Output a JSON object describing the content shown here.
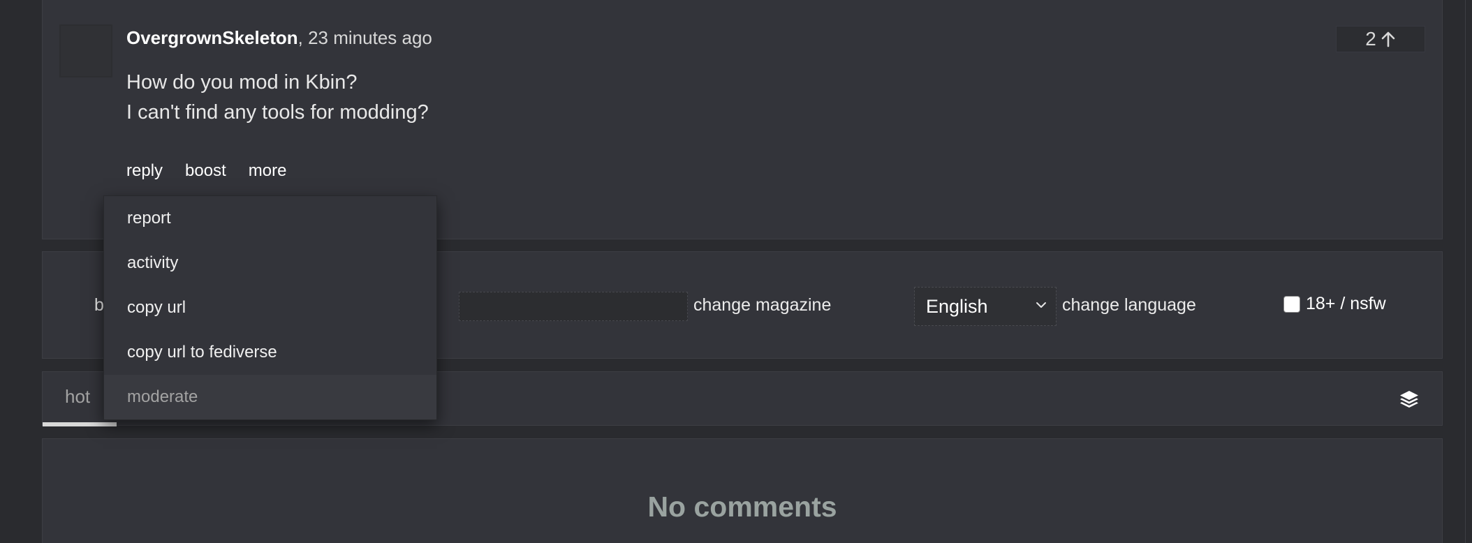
{
  "post": {
    "author": "OvergrownSkeleton",
    "time_sep": ",",
    "time": "23 minutes ago",
    "vote_count": "2",
    "body_line1": "How do you mod in Kbin?",
    "body_line2": "I can't find any tools for modding?",
    "actions": {
      "reply": "reply",
      "boost": "boost",
      "more": "more"
    }
  },
  "menu": {
    "items": [
      {
        "label": "report"
      },
      {
        "label": "activity"
      },
      {
        "label": "copy url"
      },
      {
        "label": "copy url to fediverse"
      },
      {
        "label": "moderate"
      }
    ]
  },
  "form": {
    "partial_label": "b",
    "magazine_value": "",
    "magazine_label": "change magazine",
    "language_selected": "English",
    "language_label": "change language",
    "nsfw_label": "18+ / nsfw",
    "nsfw_checked": false
  },
  "tabs": {
    "active": "hot"
  },
  "comments": {
    "empty_text": "No comments"
  },
  "icons": {
    "vote": "arrow-up-icon",
    "language_dropdown": "chevron-down-icon",
    "view_mode": "layers-icon"
  }
}
